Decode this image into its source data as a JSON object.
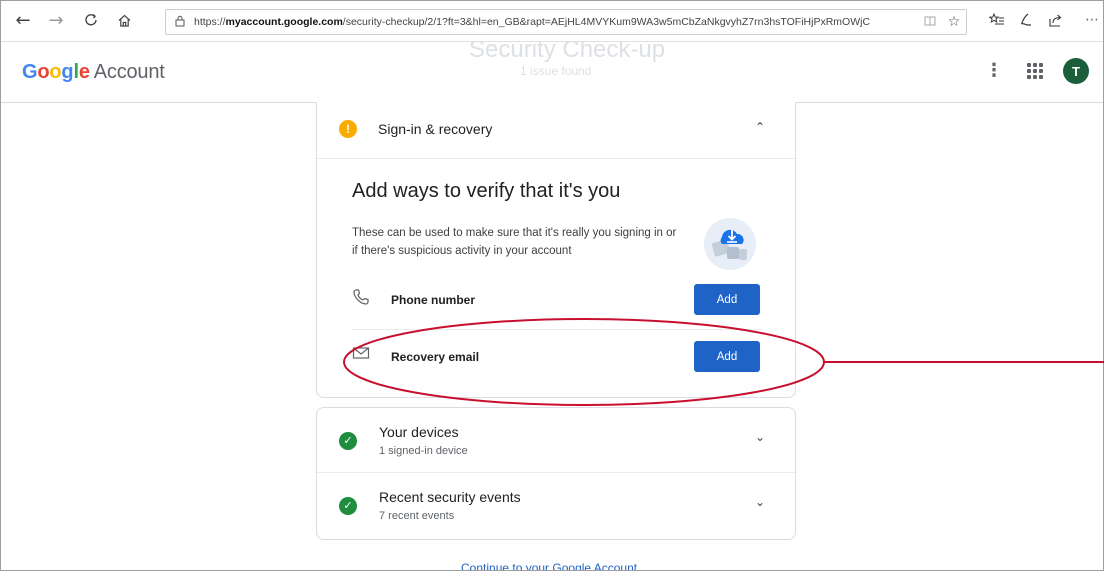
{
  "browser": {
    "url_prefix": "https://",
    "url_domain": "myaccount.google.com",
    "url_rest": "/security-checkup/2/1?ft=3&hl=en_GB&rapt=AEjHL4MVYKum9WA3w5mCbZaNkgvyhZ7rn3hsTOFiHjPxRmOWjC"
  },
  "header": {
    "logo_text": "Google",
    "logo_suffix": "Account",
    "ghost_title": "Security Check-up",
    "ghost_subtitle": "1 issue found",
    "avatar_initial": "T"
  },
  "signin_card": {
    "section_title": "Sign-in & recovery",
    "heading": "Add ways to verify that it's you",
    "description": "These can be used to make sure that it's really you signing in or if there's suspicious activity in your account",
    "rows": [
      {
        "label": "Phone number",
        "button": "Add",
        "icon": "phone-icon"
      },
      {
        "label": "Recovery email",
        "button": "Add",
        "icon": "mail-icon"
      }
    ]
  },
  "status_card": {
    "rows": [
      {
        "title": "Your devices",
        "subtitle": "1 signed-in device"
      },
      {
        "title": "Recent security events",
        "subtitle": "7 recent events"
      }
    ]
  },
  "footer": {
    "continue_link": "Continue to your Google Account"
  },
  "colors": {
    "accent": "#1f63c6",
    "warning": "#f9ab00",
    "success": "#1e8e3e",
    "annotation": "#c8102e",
    "avatar": "#1b5e3a"
  }
}
